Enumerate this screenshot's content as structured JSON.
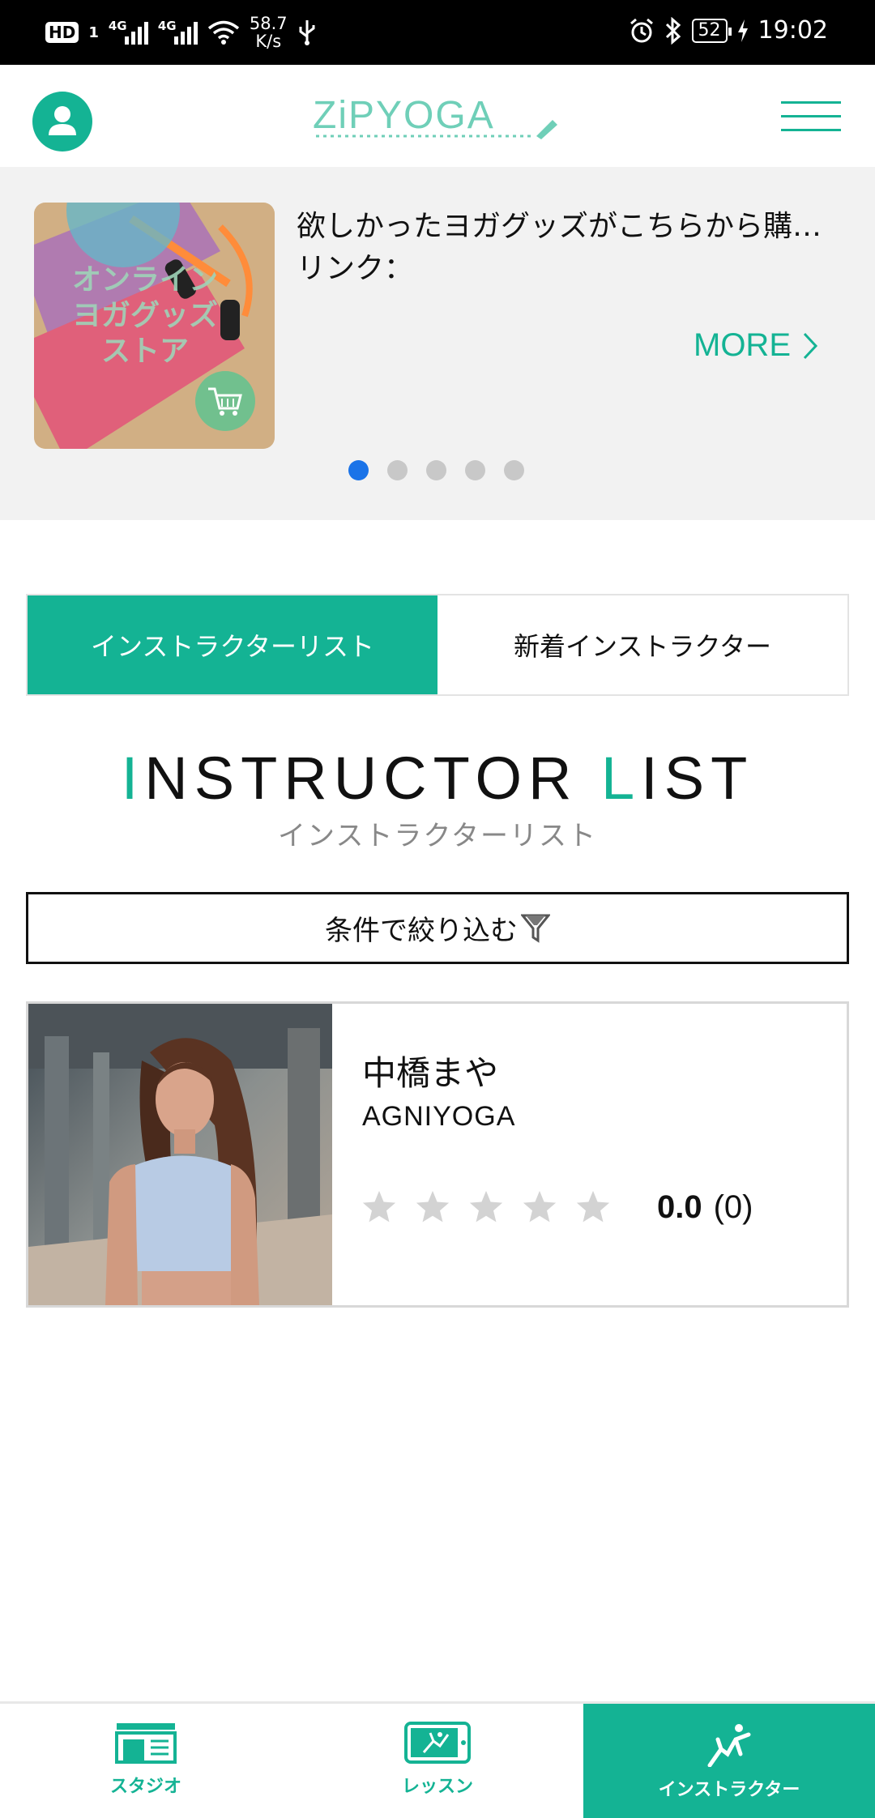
{
  "status_bar": {
    "hd": "HD",
    "sim": "1",
    "net1": "4G",
    "net2": "4G",
    "speed_value": "58.7",
    "speed_unit": "K/s",
    "battery": "52",
    "time": "19:02"
  },
  "header": {
    "logo_text": "ZiPYOGA",
    "avatar_icon": "user-icon",
    "menu_icon": "hamburger-icon"
  },
  "banner": {
    "image_text": "オンライン\nヨガグッズ\nストア",
    "line1": "欲しかったヨガグッズがこちらから購…",
    "line2": "リンク：",
    "more_label": "MORE",
    "active_slide": 1,
    "slide_count": 5
  },
  "tabs": [
    {
      "label": "インストラクターリスト",
      "active": true
    },
    {
      "label": "新着インストラクター",
      "active": false
    }
  ],
  "section": {
    "title_first": "I",
    "title_middle": "NSTRUCTOR ",
    "title_second": "L",
    "title_end": "IST",
    "subtitle": "インストラクターリスト"
  },
  "filter": {
    "label": "条件で絞り込む",
    "icon": "filter-icon"
  },
  "instructors": [
    {
      "name": "中橋まや",
      "studio": "AGNIYOGA",
      "stars": 0,
      "max_stars": 5,
      "rating": "0.0",
      "review_count": "(0)"
    }
  ],
  "bottom_nav": [
    {
      "label": "スタジオ",
      "icon": "studio-icon",
      "active": false
    },
    {
      "label": "レッスン",
      "icon": "lesson-icon",
      "active": false
    },
    {
      "label": "インストラクター",
      "icon": "instructor-icon",
      "active": true
    }
  ],
  "colors": {
    "accent": "#14b394",
    "dot_active": "#1a73e8",
    "dot_inactive": "#c8c8c8",
    "star_empty": "#d3d3d3"
  }
}
